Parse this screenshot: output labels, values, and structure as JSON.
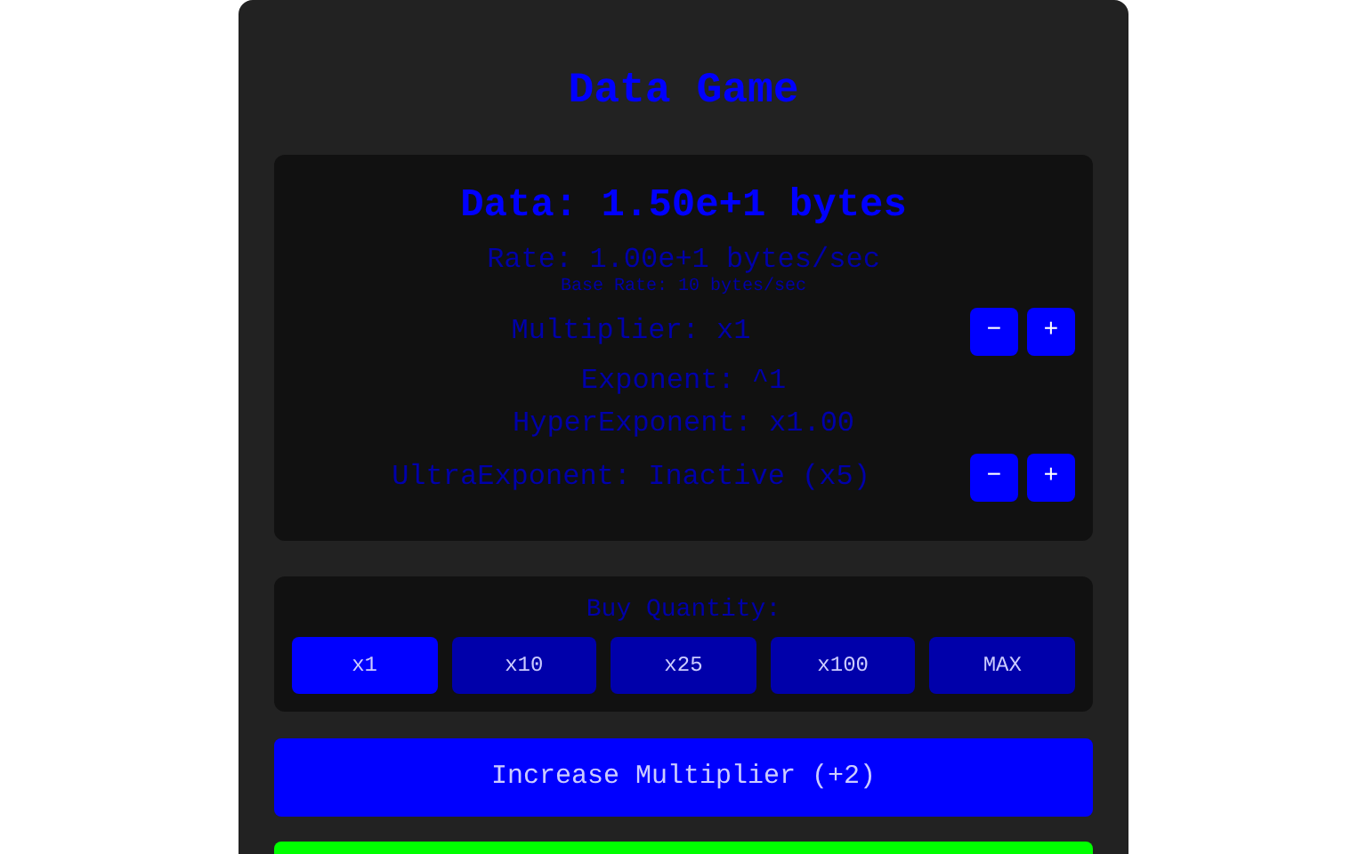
{
  "title": "Data Game",
  "stats": {
    "data": "Data: 1.50e+1 bytes",
    "rate": "Rate: 1.00e+1 bytes/sec",
    "base_rate": "Base Rate: 10 bytes/sec",
    "rows": [
      {
        "kind": "control",
        "label": "Multiplier: x1",
        "minus": "−",
        "plus": "+"
      },
      {
        "kind": "plain",
        "label": "Exponent: ^1"
      },
      {
        "kind": "plain",
        "label": "HyperExponent: x1.00"
      },
      {
        "kind": "control",
        "label": "UltraExponent: Inactive (x5)",
        "minus": "−",
        "plus": "+"
      }
    ]
  },
  "buy": {
    "label": "Buy Quantity:",
    "options": [
      {
        "label": "x1",
        "selected": true
      },
      {
        "label": "x10",
        "selected": false
      },
      {
        "label": "x25",
        "selected": false
      },
      {
        "label": "x100",
        "selected": false
      },
      {
        "label": "MAX",
        "selected": false
      }
    ]
  },
  "actions": [
    {
      "kind": "blue",
      "label": "Increase Multiplier (+2)"
    },
    {
      "kind": "green"
    }
  ]
}
